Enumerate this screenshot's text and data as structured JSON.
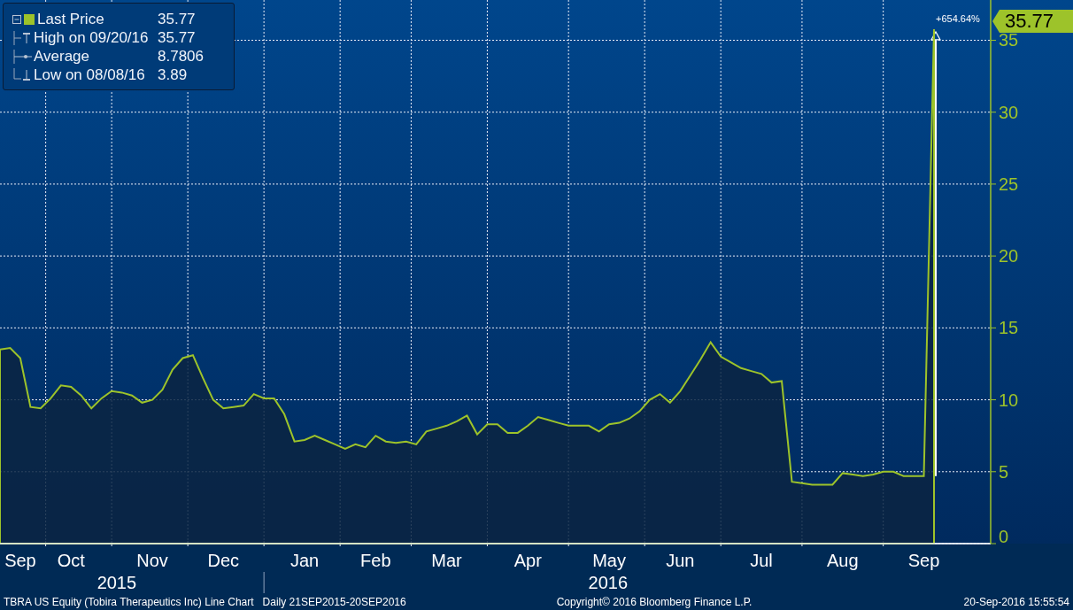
{
  "legend": {
    "items": [
      {
        "kind": "series",
        "value": "35.77"
      },
      {
        "kind": "high",
        "label": "High on 09/20/16",
        "value": "35.77"
      },
      {
        "kind": "average",
        "label": "Average",
        "value": "8.7806"
      },
      {
        "kind": "low",
        "label": "Low on 08/08/16",
        "value": "3.89"
      }
    ]
  },
  "price_tag": "35.77",
  "chart_data": {
    "type": "area",
    "grid": true,
    "ylim": [
      0,
      37.8
    ],
    "categories": [
      null,
      null,
      "Sep",
      null,
      null,
      null,
      null,
      "Oct",
      null,
      null,
      null,
      null,
      null,
      null,
      null,
      "Nov",
      null,
      null,
      null,
      null,
      null,
      null,
      "Dec",
      null,
      null,
      null,
      null,
      null,
      null,
      null,
      "Jan",
      null,
      null,
      null,
      null,
      null,
      null,
      "Feb",
      null,
      null,
      null,
      null,
      null,
      null,
      "Mar",
      null,
      null,
      null,
      null,
      null,
      null,
      null,
      "Apr",
      null,
      null,
      null,
      null,
      null,
      null,
      null,
      "May",
      null,
      null,
      null,
      null,
      null,
      null,
      "Jun",
      null,
      null,
      null,
      null,
      null,
      null,
      null,
      "Jul",
      null,
      null,
      null,
      null,
      null,
      null,
      null,
      "Aug",
      null,
      null,
      null,
      null,
      null,
      null,
      null,
      "Sep",
      null
    ],
    "series": [
      {
        "name": "Last Price",
        "color": "#9dc32a",
        "values": [
          13.5,
          13.6,
          12.9,
          9.5,
          9.4,
          10.1,
          11.0,
          10.9,
          10.3,
          9.4,
          10.1,
          10.6,
          10.5,
          10.3,
          9.8,
          10.0,
          10.7,
          12.1,
          12.9,
          13.1,
          11.5,
          10.0,
          9.4,
          9.5,
          9.6,
          10.4,
          10.1,
          10.1,
          9.0,
          7.1,
          7.2,
          7.5,
          7.2,
          6.9,
          6.6,
          6.9,
          6.7,
          7.5,
          7.1,
          7.0,
          7.1,
          6.9,
          7.8,
          8.0,
          8.2,
          8.5,
          8.9,
          7.6,
          8.3,
          8.3,
          7.7,
          7.7,
          8.2,
          8.8,
          8.6,
          8.4,
          8.2,
          8.2,
          8.2,
          7.8,
          8.3,
          8.4,
          8.7,
          9.2,
          10.0,
          10.4,
          9.8,
          10.6,
          11.7,
          12.8,
          14.0,
          13.0,
          12.6,
          12.2,
          12.0,
          11.8,
          11.2,
          11.3,
          4.3,
          4.2,
          4.1,
          4.1,
          4.1,
          4.9,
          4.8,
          4.7,
          4.8,
          5.0,
          5.0,
          4.7,
          4.7,
          4.7,
          35.77
        ]
      }
    ],
    "yticks": [
      0,
      5,
      10,
      15,
      20,
      25,
      30,
      35
    ],
    "annotations": [
      "+654.64%"
    ]
  },
  "year_labels": [
    "2015",
    "2016"
  ],
  "footer": {
    "description": "TBRA US Equity (Tobira Therapeutics Inc) Line Chart",
    "period": "Daily 21SEP2015-20SEP2016",
    "copyright": "Copyright© 2016 Bloomberg Finance L.P.",
    "timestamp": "20-Sep-2016 15:55:54"
  }
}
